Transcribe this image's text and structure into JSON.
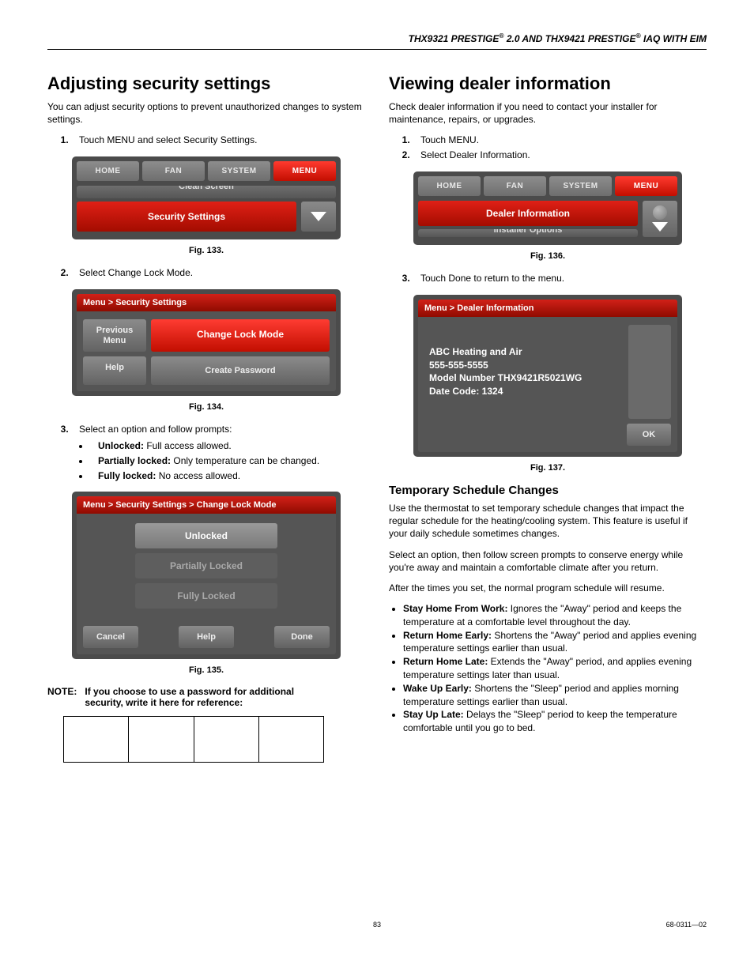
{
  "header": "THX9321 PRESTIGE® 2.0 AND THX9421 PRESTIGE® IAQ WITH EIM",
  "left": {
    "h_adjust": "Adjusting security settings",
    "p_adjust": "You can adjust security options to prevent unauthorized changes to system settings.",
    "step1": "Touch MENU and select Security Settings.",
    "fig133": {
      "tabs": {
        "home": "HOME",
        "fan": "FAN",
        "system": "SYSTEM",
        "menu": "MENU"
      },
      "cut_label": "Clean Screen",
      "selected": "Security Settings",
      "caption": "Fig. 133."
    },
    "step2": "Select Change Lock Mode.",
    "fig134": {
      "crumb": "Menu > Security Settings",
      "prev": "Previous Menu",
      "help": "Help",
      "change": "Change Lock Mode",
      "create": "Create Password",
      "caption": "Fig. 134."
    },
    "step3": "Select an option and follow prompts:",
    "opts": {
      "unlocked_b": "Unlocked:",
      "unlocked_t": " Full access allowed.",
      "partial_b": "Partially locked:",
      "partial_t": " Only temperature can be changed.",
      "full_b": "Fully locked:",
      "full_t": " No access allowed."
    },
    "fig135": {
      "crumb": "Menu > Security Settings > Change Lock Mode",
      "o1": "Unlocked",
      "o2": "Partially Locked",
      "o3": "Fully Locked",
      "cancel": "Cancel",
      "help": "Help",
      "done": "Done",
      "caption": "Fig. 135."
    },
    "note_lbl": "NOTE:",
    "note_body": "If you choose to use a password for additional security, write it here for reference:"
  },
  "right": {
    "h_dealer": "Viewing dealer information",
    "p_dealer": "Check dealer information if you need to contact your installer for maintenance, repairs, or upgrades.",
    "step1": "Touch MENU.",
    "step2": "Select Dealer Information.",
    "fig136": {
      "tabs": {
        "home": "HOME",
        "fan": "FAN",
        "system": "SYSTEM",
        "menu": "MENU"
      },
      "selected": "Dealer Information",
      "cut_label": "Installer Options",
      "caption": "Fig. 136."
    },
    "step3": "Touch Done to return to the menu.",
    "fig137": {
      "crumb": "Menu > Dealer Information",
      "l1": "ABC Heating and Air",
      "l2": "555-555-5555",
      "l3": "Model Number THX9421R5021WG",
      "l4": "Date Code: 1324",
      "ok": "OK",
      "caption": "Fig. 137."
    },
    "h_temp": "Temporary Schedule Changes",
    "p_temp1": "Use the thermostat to set temporary schedule changes that impact the regular schedule for the heating/cooling system. This feature is useful if your daily schedule sometimes changes.",
    "p_temp2": "Select an option, then follow screen prompts to conserve energy while you're away and maintain a comfortable climate after you return.",
    "p_temp3": "After the times you set, the normal program schedule will resume.",
    "temp_opts": {
      "a_b": "Stay Home From Work:",
      "a_t": " Ignores the \"Away\" period and keeps the temperature at a comfortable level throughout the day.",
      "b_b": "Return Home Early:",
      "b_t": " Shortens the \"Away\" period and applies evening temperature settings earlier than usual.",
      "c_b": "Return Home Late:",
      "c_t": " Extends the \"Away\" period, and applies evening temperature settings later than usual.",
      "d_b": "Wake Up Early:",
      "d_t": " Shortens the \"Sleep\" period and applies morning temperature settings earlier than usual.",
      "e_b": "Stay Up Late:",
      "e_t": " Delays the \"Sleep\" period to keep the temperature comfortable until you go to bed."
    }
  },
  "footer": {
    "page": "83",
    "doc": "68-0311—02"
  }
}
